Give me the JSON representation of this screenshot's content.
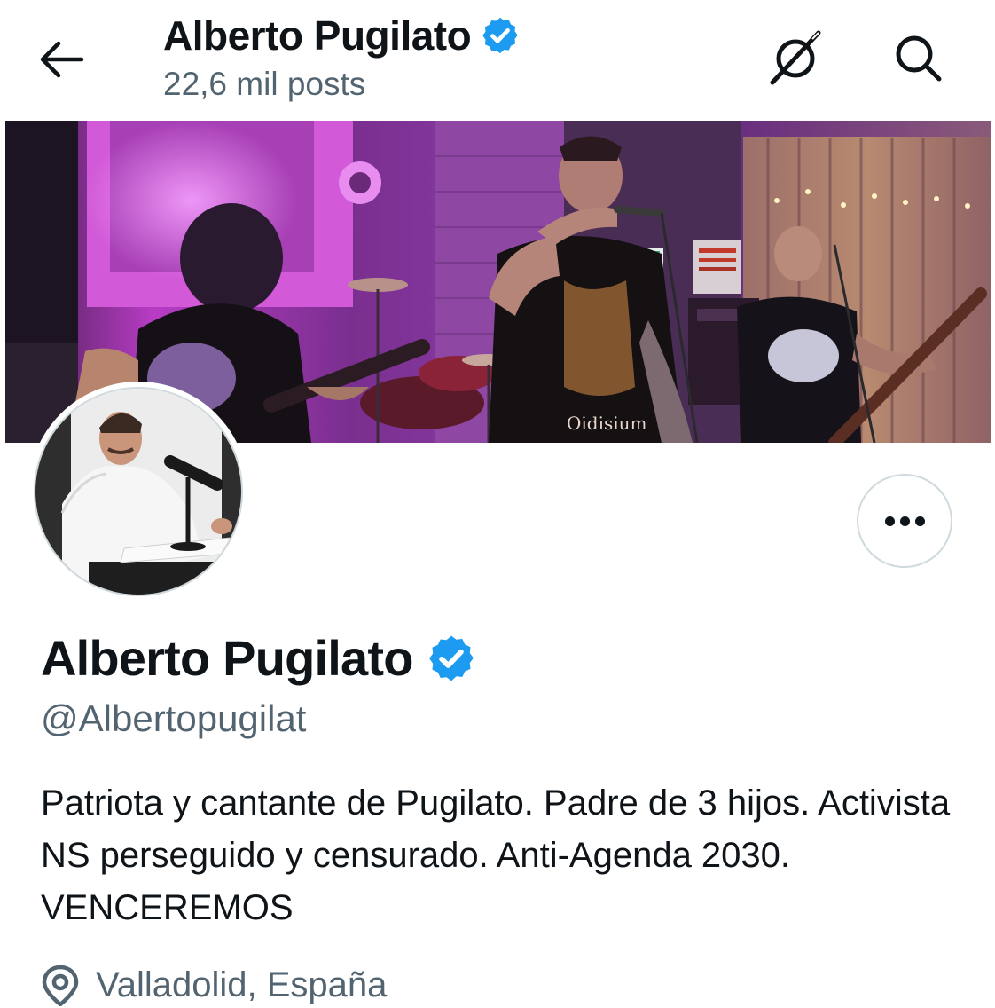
{
  "header": {
    "title": "Alberto Pugilato",
    "posts_count": "22,6 mil posts",
    "back_icon": "arrow-left-icon",
    "grok_icon": "grok-icon",
    "search_icon": "search-icon"
  },
  "banner": {
    "description_icon": "banner-image",
    "shirt_text": "Oidisium"
  },
  "profile": {
    "name": "Alberto Pugilato",
    "handle": "@Albertopugilat",
    "bio": "Patriota y cantante de Pugilato. Padre de 3 hijos. Activista NS perseguido y censurado. Anti-Agenda 2030. VENCEREMOS",
    "location": "Valladolid, España",
    "verified": true
  },
  "colors": {
    "verified_badge": "#1d9bf0",
    "secondary_text": "#536471",
    "primary_text": "#0f1419",
    "border": "#cfd9de"
  }
}
